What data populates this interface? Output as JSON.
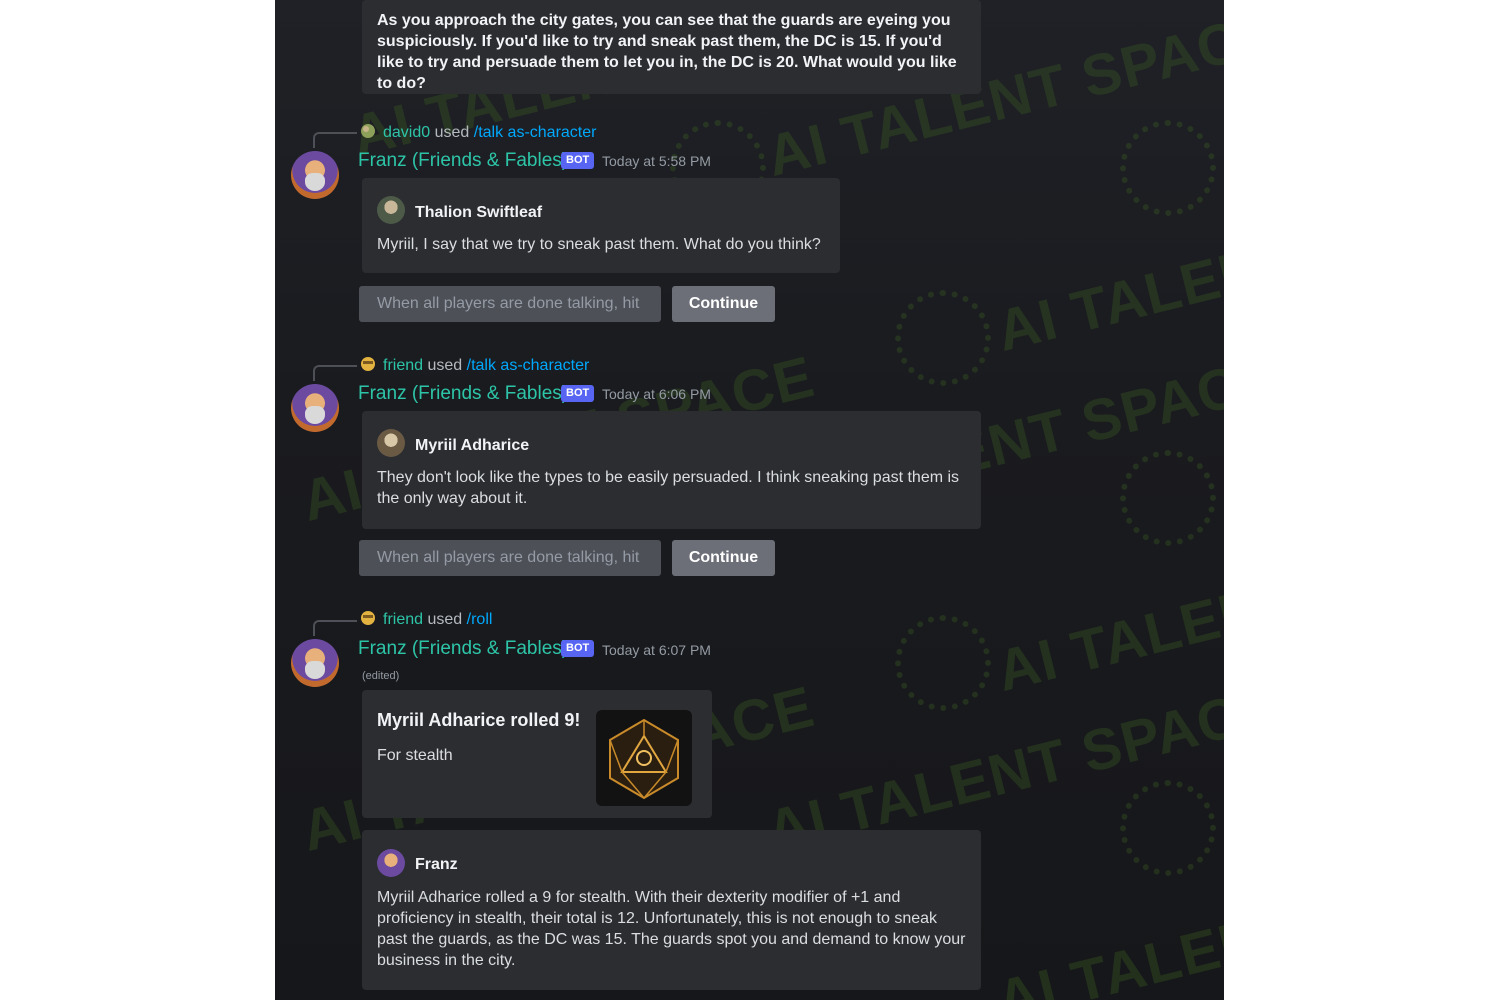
{
  "intro_message": "As you approach the city gates, you can see that the guards are eyeing you suspiciously. If you'd like to try and sneak past them, the DC is 15. If you'd like to try and persuade them to let you in, the DC is 20. What would you like to do?",
  "watermark_text": "AI TALENT SPACE",
  "colors": {
    "background": "#1f2126",
    "embed": "#2b2d31",
    "author": "#2dc5a8",
    "command": "#00a8fc",
    "bot_tag": "#5865f2",
    "button": "#6d6f78",
    "watermark": "#3c5f23"
  },
  "messages": [
    {
      "reply": {
        "user": "david0",
        "used": "used",
        "command": "/talk as-character",
        "icon": "user-avatar-icon"
      },
      "author": "Franz (Friends & Fables)",
      "bot_tag": "BOT",
      "timestamp": "Today at 5:58 PM",
      "character": {
        "name": "Thalion Swiftleaf",
        "text": "Myriil, I say that we try to sneak past them. What do you think?"
      },
      "hint": "When all players are done talking, hit",
      "button": "Continue"
    },
    {
      "reply": {
        "user": "friend",
        "used": "used",
        "command": "/talk as-character",
        "icon": "emoji-face-icon"
      },
      "author": "Franz (Friends & Fables)",
      "bot_tag": "BOT",
      "timestamp": "Today at 6:06 PM",
      "character": {
        "name": "Myriil Adharice",
        "text": "They don't look like the types to be easily persuaded. I think sneaking past them is the only way about it."
      },
      "hint": "When all players are done talking, hit",
      "button": "Continue"
    },
    {
      "reply": {
        "user": "friend",
        "used": "used",
        "command": "/roll",
        "icon": "emoji-face-icon"
      },
      "author": "Franz (Friends & Fables)",
      "bot_tag": "BOT",
      "timestamp": "Today at 6:07 PM",
      "edited": "(edited)",
      "roll": {
        "title": "Myriil Adharice rolled 9!",
        "description": "For stealth",
        "image_icon": "d20-dice-icon"
      },
      "narrator": {
        "name": "Franz",
        "text": "Myriil Adharice rolled a 9 for stealth. With their dexterity modifier of +1 and proficiency in stealth, their total is 12. Unfortunately, this is not enough to sneak past the guards, as the DC was 15. The guards spot you and demand to know your business in the city."
      }
    }
  ]
}
